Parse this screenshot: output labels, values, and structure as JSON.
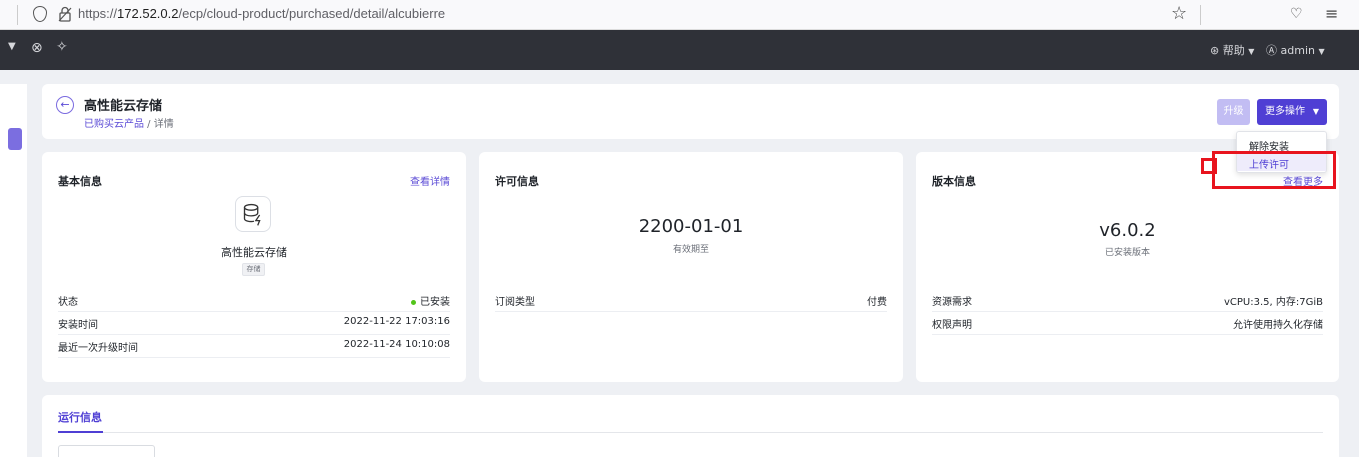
{
  "browser": {
    "url_prefix": "https://",
    "url_host": "172.52.0.2",
    "url_path": "/ecp/cloud-product/purchased/detail/alcubierre"
  },
  "header": {
    "help_label": "帮助",
    "user_label": "admin"
  },
  "page": {
    "title": "高性能云存储",
    "breadcrumb_parent": "已购买云产品",
    "breadcrumb_sep": " / ",
    "breadcrumb_current": "详情",
    "upgrade_label": "升级",
    "more_label": "更多操作"
  },
  "dropdown": {
    "items": [
      "解除安装",
      "上传许可"
    ]
  },
  "basic_info": {
    "title": "基本信息",
    "link": "查看详情",
    "product_name": "高性能云存储",
    "tag": "存储",
    "rows": [
      {
        "key": "状态",
        "value": "已安装"
      },
      {
        "key": "安装时间",
        "value": "2022-11-22 17:03:16"
      },
      {
        "key": "最近一次升级时间",
        "value": "2022-11-24 10:10:08"
      }
    ]
  },
  "license_info": {
    "title": "许可信息",
    "expiry": "2200-01-01",
    "expiry_label": "有效期至",
    "rows": [
      {
        "key": "订阅类型",
        "value": "付费"
      }
    ]
  },
  "version_info": {
    "title": "版本信息",
    "link": "查看更多",
    "version": "v6.0.2",
    "version_label": "已安装版本",
    "rows": [
      {
        "key": "资源需求",
        "value": "vCPU:3.5, 内存:7GiB"
      },
      {
        "key": "权限声明",
        "value": "允许使用持久化存储"
      }
    ]
  },
  "runtime": {
    "tab_label": "运行信息"
  },
  "colors": {
    "accent": "#4f3fd4",
    "annotation": "#e8141e",
    "status_ok": "#52c41a"
  }
}
